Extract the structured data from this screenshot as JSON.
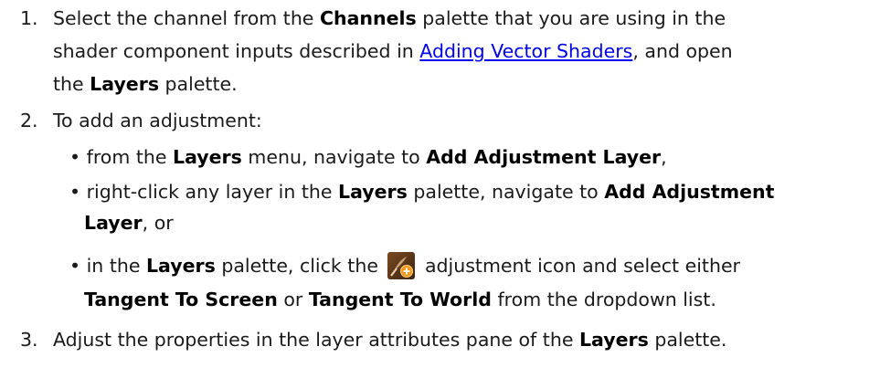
{
  "steps": {
    "s1": {
      "num": "1.",
      "p1": "Select the channel from the ",
      "b1": "Channels",
      "p2": " palette that you are using in the",
      "p3": "shader component inputs described in ",
      "link": "Adding Vector Shaders",
      "p4": ", and open",
      "p5": "the ",
      "b2": "Layers",
      "p6": " palette."
    },
    "s2": {
      "num": "2.",
      "intro": "To add an adjustment:",
      "bullet1": {
        "p1": "• from the ",
        "b1": "Layers",
        "p2": " menu, navigate to ",
        "b2": "Add Adjustment Layer",
        "p3": ","
      },
      "bullet2": {
        "p1": "• right-click any layer in the ",
        "b1": "Layers",
        "p2": " palette, navigate to ",
        "b2": "Add Adjustment",
        "b3": "Layer",
        "p3": ", or"
      },
      "bullet3": {
        "p1": "• in the ",
        "b1": "Layers",
        "p2": " palette, click the ",
        "p3": " adjustment icon and select either",
        "b2": "Tangent To Screen",
        "p4": " or ",
        "b3": "Tangent To World",
        "p5": " from the dropdown list."
      }
    },
    "s3": {
      "num": "3.",
      "p1": "Adjust the properties in the layer attributes pane of the ",
      "b1": "Layers",
      "p2": " palette."
    }
  },
  "icon": "adjustment-layer-icon"
}
